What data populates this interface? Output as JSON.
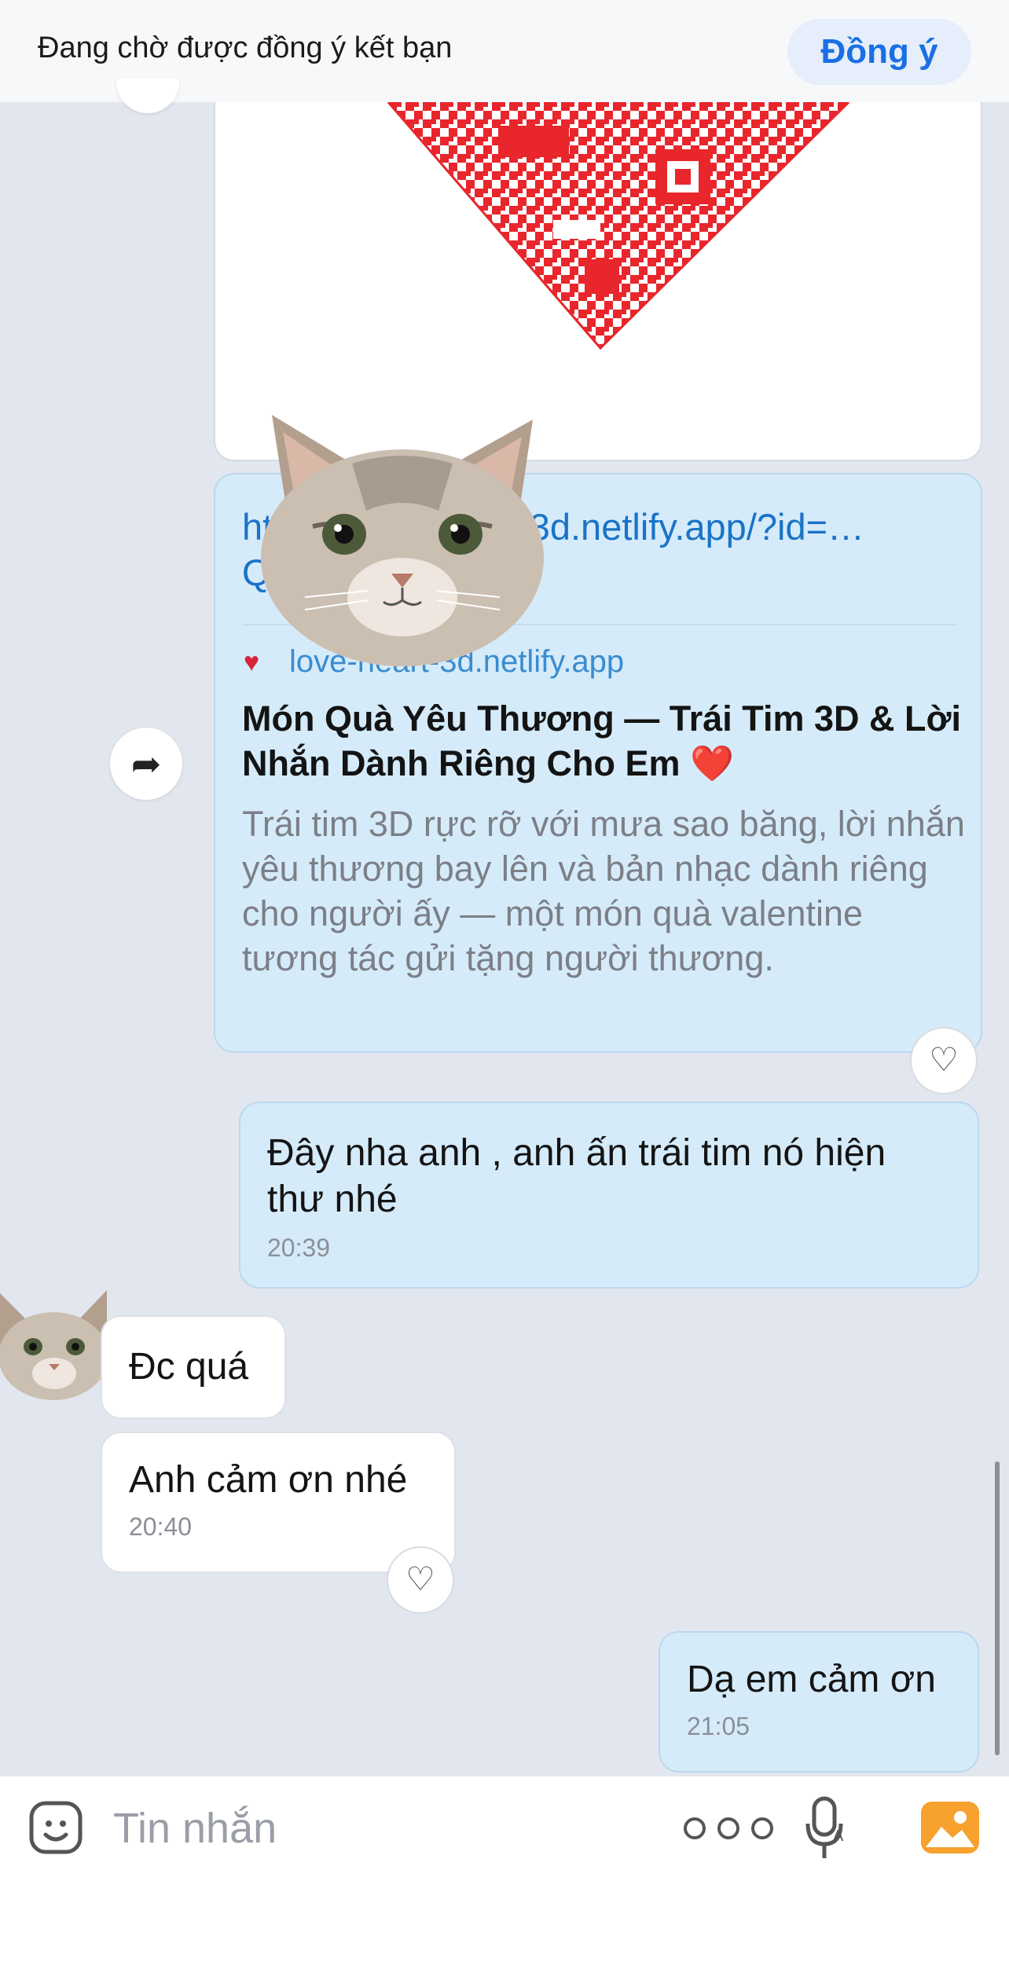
{
  "banner": {
    "text": "Đang chờ được đồng ý kết bạn",
    "accept_label": "Đồng ý"
  },
  "link_card": {
    "url": "https://love-heart-3d.netlify.app/?id=…Q9zT207IM6",
    "domain": "love-heart-3d.netlify.app",
    "title": "Món Quà Yêu Thương — Trái Tim 3D & Lời Nhắn Dành Riêng Cho Em",
    "title_emoji": "❤️",
    "description": "Trái tim 3D rực rỡ với mưa sao băng, lời nhắn yêu thương bay lên và bản nhạc dành riêng cho người ấy — một món quà valentine tương tác gửi tặng người thương."
  },
  "messages": [
    {
      "from": "me",
      "text": "Đây nha anh , anh ấn trái tim nó hiện thư nhé",
      "time": "20:39"
    },
    {
      "from": "them",
      "text": "Đc quá"
    },
    {
      "from": "them",
      "text": "Anh cảm ơn nhé",
      "time": "20:40"
    },
    {
      "from": "me",
      "text": "Dạ em cảm ơn",
      "time": "21:05"
    }
  ],
  "input": {
    "placeholder": "Tin nhắn"
  },
  "icons": {
    "share": "share-forward-icon",
    "react": "heart-outline-icon",
    "sticker": "sticker-smile-icon",
    "more": "more-dots-icon",
    "mic": "voice-to-text-icon",
    "gallery": "image-gallery-icon"
  },
  "colors": {
    "accent": "#1a6fe3",
    "my_bubble": "#d5ebfa",
    "their_bubble": "#ffffff",
    "background": "#e2e6ee",
    "qr": "#e8262c",
    "gallery": "#f7a12f"
  }
}
